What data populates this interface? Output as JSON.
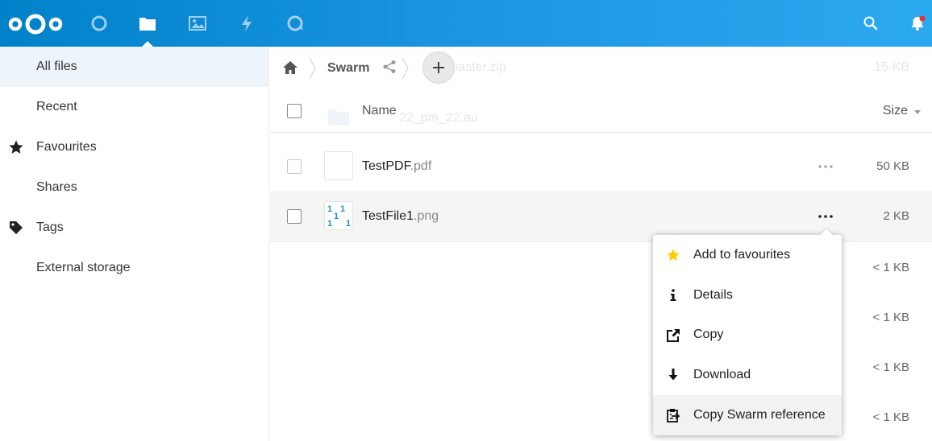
{
  "header": {
    "apps": [
      {
        "name": "dashboard-icon"
      },
      {
        "name": "files-icon",
        "active": true
      },
      {
        "name": "photos-icon"
      },
      {
        "name": "activity-icon"
      },
      {
        "name": "talk-icon"
      }
    ],
    "right": [
      {
        "name": "search-icon"
      },
      {
        "name": "notifications-icon"
      }
    ],
    "accent": "#0082c9",
    "notification_dot": "#e9322d"
  },
  "sidebar": {
    "items": [
      {
        "label": "All files",
        "active": true
      },
      {
        "label": "Recent"
      },
      {
        "label": "Favourites",
        "icon": "star-icon"
      },
      {
        "label": "Shares"
      },
      {
        "label": "Tags",
        "icon": "tag-icon"
      },
      {
        "label": "External storage"
      }
    ]
  },
  "breadcrumb": {
    "folder": "Swarm"
  },
  "ghost_text": {
    "row1": "master.zip",
    "row1_size": "15 KB",
    "row2": "22_pm_22.au"
  },
  "table": {
    "col_name": "Name",
    "col_size": "Size",
    "files": [
      {
        "base": "TestPDF",
        "ext": ".pdf",
        "size": "50 KB"
      },
      {
        "base": "TestFile1",
        "ext": ".png",
        "size": "2 KB"
      }
    ],
    "extra_sizes": [
      "< 1 KB",
      "< 1 KB",
      "< 1 KB",
      "< 1 KB"
    ],
    "png_thumb_digits": [
      "1",
      "1",
      "1",
      "1",
      "1"
    ]
  },
  "menu": {
    "items": [
      {
        "label": "Add to favourites",
        "icon": "star-icon",
        "icon_color": "#fc0"
      },
      {
        "label": "Details",
        "icon": "info-icon"
      },
      {
        "label": "Copy",
        "icon": "external-link-icon"
      },
      {
        "label": "Download",
        "icon": "download-icon"
      },
      {
        "label": "Copy Swarm reference",
        "icon": "clipboard-icon"
      }
    ]
  }
}
